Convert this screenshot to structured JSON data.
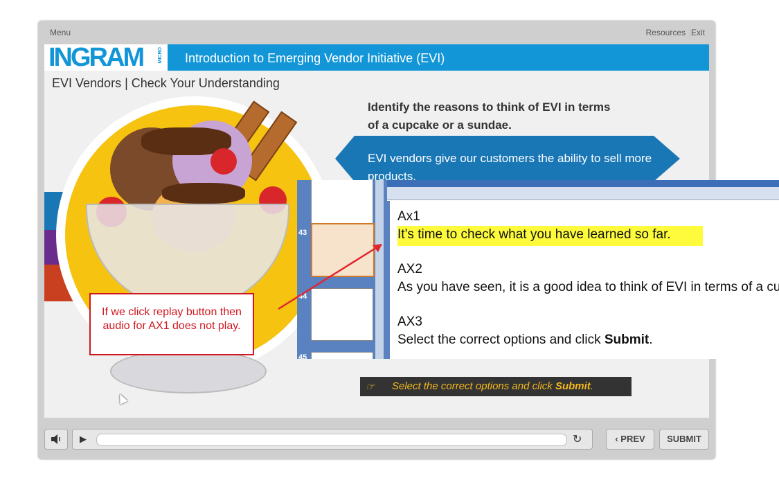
{
  "topbar": {
    "menu": "Menu",
    "resources": "Resources",
    "exit": "Exit"
  },
  "header": {
    "logo": "INGRAM",
    "logo_sub": "MICRO",
    "course_title": "Introduction to Emerging Vendor Initiative (EVI)"
  },
  "slide": {
    "subtitle": "EVI Vendors | Check Your Understanding",
    "question": "Identify the reasons to think of EVI in terms of a cupcake or a sundae.",
    "answer_option": "EVI vendors give our customers the ability to sell more products.",
    "instruction_prefix": "Select the correct options and click ",
    "instruction_bold": "Submit",
    "instruction_suffix": "."
  },
  "callout": {
    "text": "If we click replay button then audio for AX1 does not play."
  },
  "notes_panel": {
    "thumbnails": [
      {
        "num": ""
      },
      {
        "num": "43"
      },
      {
        "num": "44"
      },
      {
        "num": "45"
      }
    ],
    "blocks": [
      {
        "label": "Ax1",
        "text": "It’s time to check what you have learned so far."
      },
      {
        "label": "AX2",
        "text": "As you have seen, it is a good idea to think of EVI in terms of a cupcake"
      },
      {
        "label": "AX3",
        "text_prefix": "Select the correct options and click ",
        "text_bold": "Submit",
        "text_suffix": "."
      }
    ]
  },
  "controls": {
    "prev": "‹ PREV",
    "submit": "SUBMIT"
  },
  "colors": {
    "brand_blue": "#1296d8",
    "answer_blue": "#1a77b6",
    "callout_red": "#d0171f",
    "highlight": "#fdfb3c",
    "instruction_gold": "#f3b81e"
  }
}
